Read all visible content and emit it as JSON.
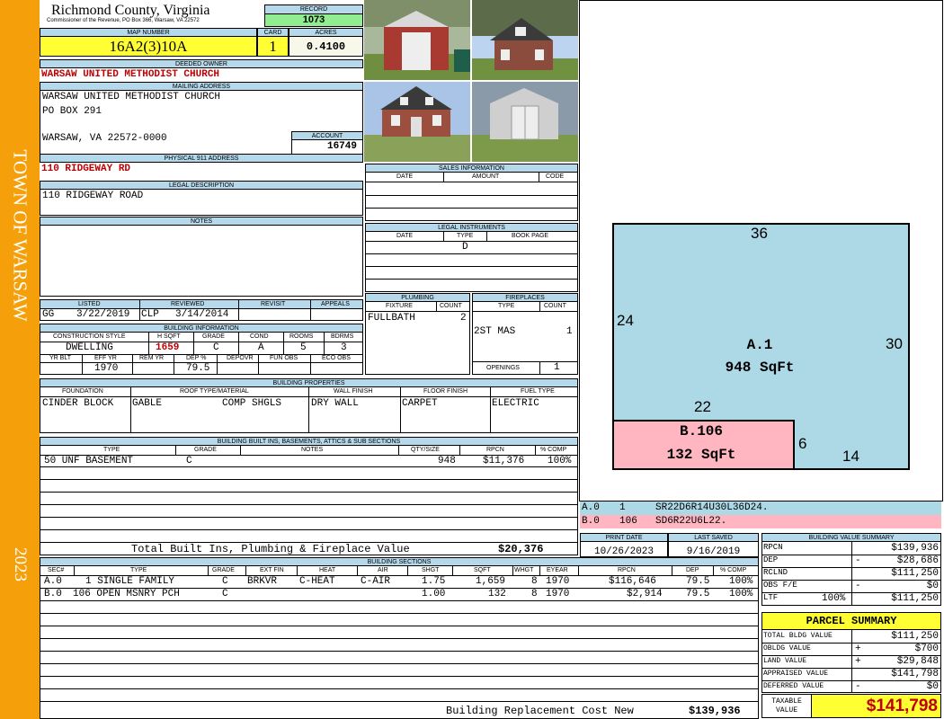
{
  "side": {
    "town": "TOWN OF WARSAW",
    "year": "2023"
  },
  "county": {
    "name": "Richmond County, Virginia",
    "address": "Commissioner of the Revenue, PO Box 366, Warsaw, VA 22572"
  },
  "record": {
    "label": "RECORD",
    "value": "1073"
  },
  "map": {
    "label": "MAP NUMBER",
    "value": "16A2(3)10A",
    "card_label": "CARD",
    "card": "1",
    "acres_label": "ACRES",
    "acres": "0.4100"
  },
  "owner": {
    "label": "DEEDED OWNER",
    "value": "WARSAW UNITED METHODIST CHURCH"
  },
  "mailing": {
    "label": "MAILING ADDRESS",
    "line1": "WARSAW UNITED METHODIST CHURCH",
    "line2": "PO BOX 291",
    "line3": "WARSAW, VA 22572-0000"
  },
  "account": {
    "label": "ACCOUNT",
    "value": "16749"
  },
  "physical": {
    "label": "PHYSICAL 911 ADDRESS",
    "value": "110 RIDGEWAY RD"
  },
  "legal": {
    "label": "LEGAL DESCRIPTION",
    "value": "110 RIDGEWAY ROAD"
  },
  "notes": {
    "label": "NOTES"
  },
  "sales": {
    "label": "SALES INFORMATION",
    "cols": [
      "DATE",
      "AMOUNT",
      "CODE"
    ]
  },
  "instruments": {
    "label": "LEGAL INSTRUMENTS",
    "cols": [
      "DATE",
      "TYPE",
      "BOOK PAGE"
    ],
    "type_value": "D"
  },
  "listing": {
    "cols": [
      "LISTED",
      "REVIEWED",
      "REVISIT",
      "APPEALS"
    ],
    "listed_by": "GG",
    "listed_date": "3/22/2019",
    "reviewed_by": "CLP",
    "reviewed_date": "3/14/2014"
  },
  "building_info": {
    "label": "BUILDING INFORMATION",
    "cols": [
      "CONSTRUCTION STYLE",
      "H SQFT",
      "GRADE",
      "COND",
      "ROOMS",
      "BDRMS"
    ],
    "style": "DWELLING",
    "hsqft": "1659",
    "grade": "C",
    "cond": "A",
    "rooms": "5",
    "bdrms": "3",
    "cols2": [
      "YR BLT",
      "EFF YR",
      "REM YR",
      "DEP %",
      "DEPOVR",
      "FUN OBS",
      "ECO OBS"
    ],
    "eff_yr": "1970",
    "dep": "79.5"
  },
  "plumbing": {
    "label": "PLUMBING",
    "cols": [
      "FIXTURE",
      "COUNT"
    ],
    "fixture": "FULLBATH",
    "count": "2"
  },
  "fireplaces": {
    "label": "FIREPLACES",
    "cols": [
      "TYPE",
      "COUNT"
    ],
    "type": "2ST MAS",
    "count": "1",
    "openings_label": "OPENINGS",
    "openings": "1"
  },
  "properties": {
    "label": "BUILDING PROPERTIES",
    "cols": [
      "FOUNDATION",
      "ROOF TYPE/MATERIAL",
      "WALL FINISH",
      "FLOOR FINISH",
      "FUEL TYPE"
    ],
    "foundation": "CINDER BLOCK",
    "roof_type": "GABLE",
    "roof_material": "COMP SHGLS",
    "wall": "DRY WALL",
    "floor": "CARPET",
    "fuel": "ELECTRIC"
  },
  "builtins": {
    "label": "BUILDING BUILT INS, BASEMENTS, ATTICS & SUB SECTIONS",
    "cols": [
      "TYPE",
      "GRADE",
      "NOTES",
      "QTY/SIZE",
      "RPCN",
      "% COMP"
    ],
    "row": {
      "type": "50 UNF BASEMENT",
      "grade": "C",
      "qty": "948",
      "rpcn": "$11,376",
      "comp": "100%"
    },
    "total_label": "Total Built Ins, Plumbing & Fireplace Value",
    "total": "$20,376"
  },
  "dates": {
    "print_label": "PRINT DATE",
    "print": "10/26/2023",
    "saved_label": "LAST SAVED",
    "saved": "9/16/2019"
  },
  "sections": {
    "label": "BUILDING SECTIONS",
    "cols": [
      "SEC#",
      "TYPE",
      "GRADE",
      "EXT FIN",
      "HEAT",
      "AIR",
      "SHGT",
      "SQFT",
      "WHGT",
      "EYEAR",
      "RPCN",
      "DEP",
      "% COMP"
    ],
    "rows": [
      {
        "sec": "A.0",
        "type": "1 SINGLE FAMILY",
        "grade": "C",
        "ext": "BRKVR",
        "heat": "C-HEAT",
        "air": "C-AIR",
        "shgt": "1.75",
        "sqft": "1,659",
        "whgt": "8",
        "eyear": "1970",
        "rpcn": "$116,646",
        "dep": "79.5",
        "comp": "100%"
      },
      {
        "sec": "B.0",
        "type": "106 OPEN MSNRY PCH",
        "grade": "C",
        "ext": "",
        "heat": "",
        "air": "",
        "shgt": "1.00",
        "sqft": "132",
        "whgt": "8",
        "eyear": "1970",
        "rpcn": "$2,914",
        "dep": "79.5",
        "comp": "100%"
      }
    ],
    "replacement_label": "Building Replacement Cost New",
    "replacement": "$139,936"
  },
  "sketch": {
    "a_label": "A.1",
    "a_area": "948 SqFt",
    "b_label": "B.106",
    "b_area": "132 SqFt",
    "dims": [
      "36",
      "24",
      "30",
      "22",
      "6",
      "14"
    ],
    "codes": [
      {
        "sec": "A.0",
        "num": "1",
        "code": "SR22D6R14U30L36D24."
      },
      {
        "sec": "B.0",
        "num": "106",
        "code": "SD6R22U6L22."
      }
    ],
    "a_color": "#add8e6",
    "b_color": "#ffb6c1"
  },
  "value_summary": {
    "label": "BUILDING VALUE SUMMARY",
    "rows": [
      {
        "label": "RPCN",
        "sign": "",
        "pct": "",
        "value": "$139,936"
      },
      {
        "label": "DEP",
        "sign": "-",
        "pct": "",
        "value": "$28,686"
      },
      {
        "label": "RCLND",
        "sign": "",
        "pct": "",
        "value": "$111,250"
      },
      {
        "label": "OBS F/E",
        "sign": "-",
        "pct": "",
        "value": "$0"
      },
      {
        "label": "LTF",
        "sign": "",
        "pct": "100%",
        "value": "$111,250"
      }
    ]
  },
  "parcel": {
    "label": "PARCEL SUMMARY",
    "rows": [
      {
        "label": "TOTAL BLDG VALUE",
        "sign": "",
        "value": "$111,250"
      },
      {
        "label": "OBLDG VALUE",
        "sign": "+",
        "value": "$700"
      },
      {
        "label": "LAND VALUE",
        "sign": "+",
        "value": "$29,848"
      },
      {
        "label": "APPRAISED VALUE",
        "sign": "",
        "value": "$141,798"
      },
      {
        "label": "DEFERRED VALUE",
        "sign": "-",
        "value": "$0"
      }
    ],
    "taxable_label1": "TAXABLE",
    "taxable_label2": "VALUE",
    "taxable": "$141,798"
  },
  "colors": {
    "side": "#f5a00b",
    "header": "#b5d8ea",
    "yellow": "#ffff33",
    "green": "#90ee90",
    "red": "#c00000"
  }
}
